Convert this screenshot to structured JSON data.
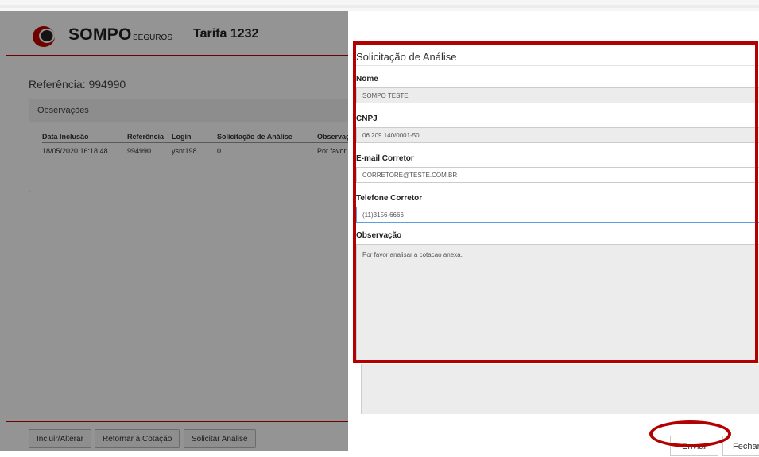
{
  "header": {
    "brand": "SOMPO",
    "brand_sub": "SEGUROS",
    "tarifa": "Tarifa 1232",
    "brand_color": "#c00000"
  },
  "reference": "Referência: 994990",
  "observacoes": {
    "title": "Observações",
    "columns": [
      "Data Inclusão",
      "Referência",
      "Login",
      "Solicitação de Análise",
      "Observaç"
    ],
    "rows": [
      [
        "18/05/2020 16:18:48",
        "994990",
        "ysnt198",
        "0",
        "Por favor"
      ]
    ]
  },
  "footer_buttons": {
    "incluir": "Incluir/Alterar",
    "retornar": "Retornar à Cotação",
    "solicitar": "Solicitar Análise"
  },
  "dialog": {
    "title": "Solicitação de Análise",
    "fields": {
      "nome": {
        "label": "Nome",
        "value": "SOMPO TESTE"
      },
      "cnpj": {
        "label": "CNPJ",
        "value": "06.209.140/0001-50"
      },
      "email": {
        "label": "E-mail Corretor",
        "value": "CORRETORE@TESTE.COM.BR"
      },
      "telefone": {
        "label": "Telefone Corretor",
        "value": "(11)3156-6666"
      },
      "observacao": {
        "label": "Observação",
        "value": "Por favor analisar a cotacao anexa."
      }
    },
    "buttons": {
      "enviar": "Enviar",
      "fechar": "Fechar"
    }
  },
  "highlight_color": "#b30000"
}
